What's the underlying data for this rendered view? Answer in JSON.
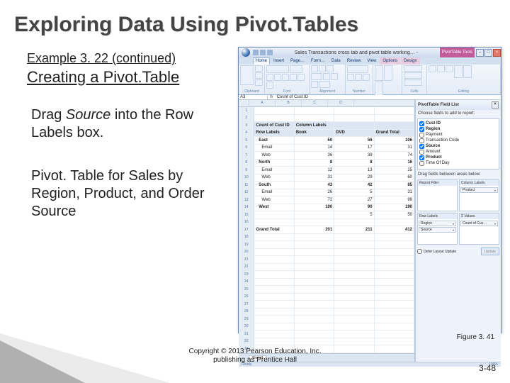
{
  "title": "Exploring Data Using Pivot.Tables",
  "example_label": "Example 3. 22 (continued)",
  "subtitle": "Creating a Pivot.Table",
  "body1_prefix": "Drag ",
  "body1_ital": "Source",
  "body1_suffix": " into the Row Labels box.",
  "body2": "Pivot. Table for Sales by Region, Product, and Order Source",
  "figure_caption": "Figure 3. 41",
  "copyright_l1": "Copyright © 2013 Pearson Education, Inc.",
  "copyright_l2": "publishing as Prentice Hall",
  "slide_num": "3-48",
  "excel": {
    "titlebar_text": "Sales Transactions cross tab and pivot table working… -",
    "contextual_tab_group": "PivotTable Tools",
    "window_min": "–",
    "window_max": "□",
    "window_close": "×",
    "tabs": [
      "Home",
      "Insert",
      "Page…",
      "Form…",
      "Data",
      "Review",
      "View",
      "Options",
      "Design"
    ],
    "ribbon_groups": [
      "Clipboard",
      "Font",
      "Alignment",
      "Number",
      "Styles",
      "Cells",
      "Editing"
    ],
    "name_box": "A3",
    "fx": "fx",
    "fx_value": "Count of Cust ID",
    "col_letters": [
      "A",
      "B",
      "C",
      "D"
    ],
    "status_ready": "Ready",
    "zoom": "100%",
    "sheet_tab": "Sheet1",
    "pivot_header": {
      "a": "Count of Cust ID",
      "b": "Column Labels"
    },
    "row_labels_hdr": "Row Labels",
    "col_vals": [
      "Book",
      "DVD",
      "Grand Total"
    ],
    "rows": [
      {
        "n": 5,
        "label": "East",
        "collapse": true,
        "b": 50,
        "c": 56,
        "d": 106,
        "bold": true
      },
      {
        "n": 6,
        "label": "Email",
        "indent": true,
        "b": 14,
        "c": 17,
        "d": 31
      },
      {
        "n": 7,
        "label": "Web",
        "indent": true,
        "b": 36,
        "c": 39,
        "d": 74
      },
      {
        "n": 8,
        "label": "North",
        "collapse": true,
        "b": 8,
        "c": 8,
        "d": 16,
        "bold": true
      },
      {
        "n": 9,
        "label": "Email",
        "indent": true,
        "b": 12,
        "c": 13,
        "d": 25
      },
      {
        "n": 10,
        "label": "Web",
        "indent": true,
        "b": 31,
        "c": 29,
        "d": 60
      },
      {
        "n": 11,
        "label": "South",
        "collapse": true,
        "b": 43,
        "c": 42,
        "d": 85,
        "bold": true
      },
      {
        "n": 12,
        "label": "Email",
        "indent": true,
        "b": 26,
        "c": 5,
        "d": 31
      },
      {
        "n": 13,
        "label": "Web",
        "indent": true,
        "b": 72,
        "c": 27,
        "d": 99
      },
      {
        "n": 14,
        "label": "West",
        "collapse": true,
        "b": 100,
        "c": 90,
        "d": 190,
        "bold": true
      },
      {
        "n": 15,
        "label": "",
        "indent": true,
        "b": "",
        "c": 5,
        "d": 50
      },
      {
        "n": 16,
        "label": "",
        "indent": true,
        "b": "",
        "c": "",
        "d": ""
      },
      {
        "n": 17,
        "label": "Grand Total",
        "b": 201,
        "c": 211,
        "d": 412,
        "grand": true
      }
    ],
    "empty_rows_start": 18,
    "empty_rows_end": 33,
    "fieldlist": {
      "title": "PivotTable Field List",
      "prompt": "Choose fields to add to report:",
      "fields": [
        {
          "name": "Cust ID",
          "checked": true
        },
        {
          "name": "Region",
          "checked": true
        },
        {
          "name": "Payment",
          "checked": false
        },
        {
          "name": "Transaction Code",
          "checked": false
        },
        {
          "name": "Source",
          "checked": true
        },
        {
          "name": "Amount",
          "checked": false
        },
        {
          "name": "Product",
          "checked": true
        },
        {
          "name": "Time Of Day",
          "checked": false
        }
      ],
      "areas_prompt": "Drag fields between areas below:",
      "area_report_filter": "Report Filter",
      "area_column_labels": "Column Labels",
      "area_row_labels": "Row Labels",
      "area_values": "Σ Values",
      "col_chip": "Product",
      "row_chip1": "Region",
      "row_chip2": "Source",
      "val_chip": "Count of Cus…",
      "defer_label": "Defer Layout Update",
      "update_btn": "Update"
    }
  }
}
